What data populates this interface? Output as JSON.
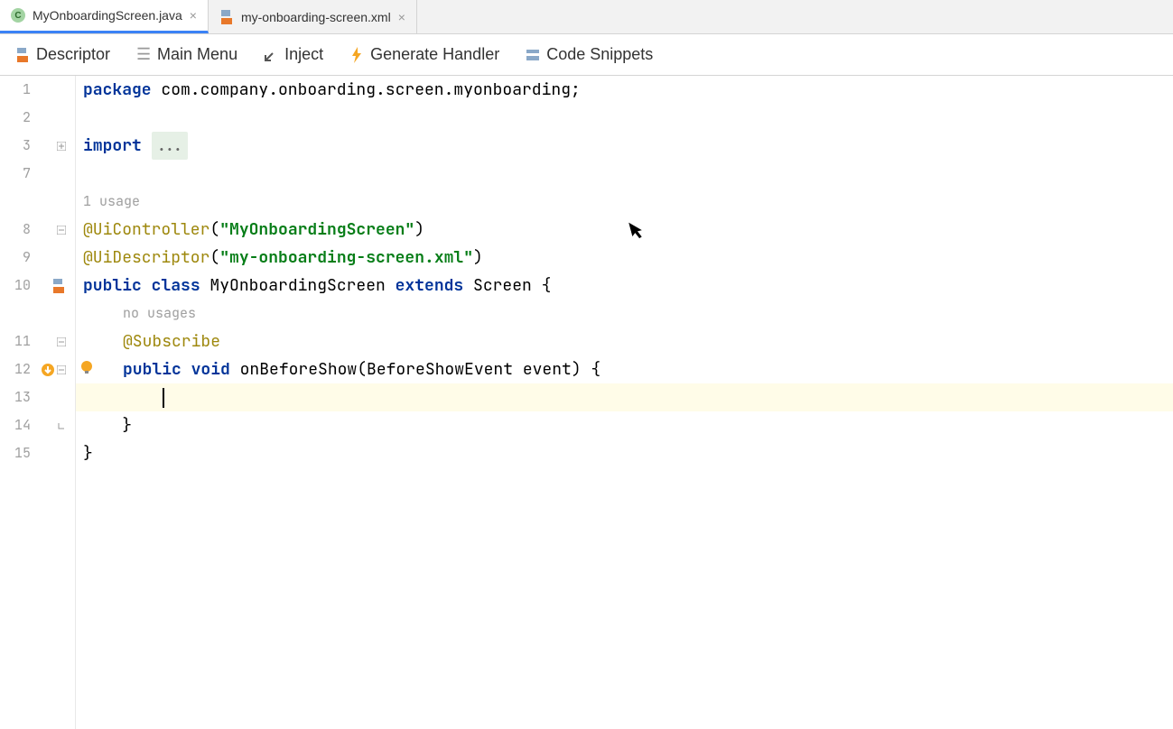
{
  "tabs": [
    {
      "label": "MyOnboardingScreen.java",
      "type": "java",
      "active": true
    },
    {
      "label": "my-onboarding-screen.xml",
      "type": "xml",
      "active": false
    }
  ],
  "toolbar": {
    "descriptor": "Descriptor",
    "mainMenu": "Main Menu",
    "inject": "Inject",
    "generateHandler": "Generate Handler",
    "codeSnippets": "Code Snippets"
  },
  "gutter": {
    "lines": [
      "1",
      "2",
      "3",
      "7",
      "",
      "8",
      "9",
      "10",
      "",
      "11",
      "12",
      "13",
      "14",
      "15"
    ]
  },
  "code": {
    "package_kw": "package",
    "package_name": " com.company.onboarding.screen.myonboarding;",
    "import_kw": "import",
    "import_folded": "...",
    "usage1": "1 usage",
    "ann_controller": "@UiController",
    "ann_controller_open": "(",
    "ann_controller_str": "\"MyOnboardingScreen\"",
    "ann_controller_close": ")",
    "ann_descriptor": "@UiDescriptor",
    "ann_descriptor_open": "(",
    "ann_descriptor_str": "\"my-onboarding-screen.xml\"",
    "ann_descriptor_close": ")",
    "public_kw": "public",
    "class_kw": "class",
    "class_name": " MyOnboardingScreen ",
    "extends_kw": "extends",
    "extends_name": " Screen {",
    "no_usages": "no usages",
    "ann_subscribe": "@Subscribe",
    "void_kw": "void",
    "method_sig": " onBeforeShow(BeforeShowEvent event) {",
    "close_brace1": "    }",
    "close_brace2": "}"
  }
}
